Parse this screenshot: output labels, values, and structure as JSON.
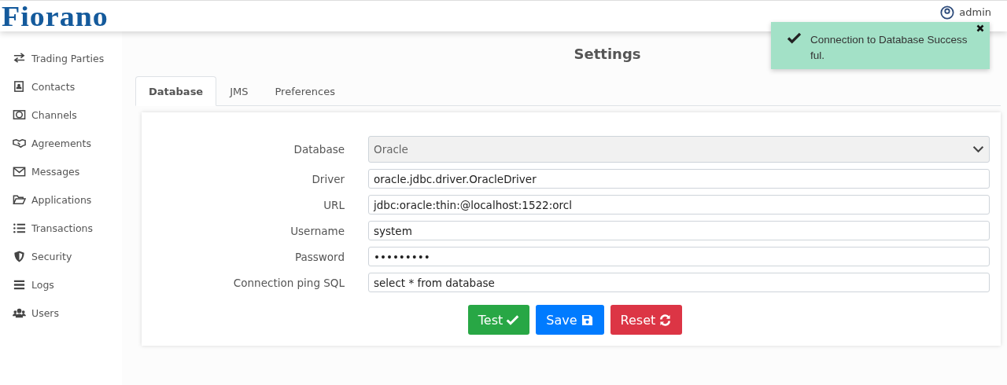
{
  "header": {
    "logo": "Fiorano",
    "user": "admin"
  },
  "sidebar": {
    "items": [
      {
        "label": "Trading Parties"
      },
      {
        "label": "Contacts"
      },
      {
        "label": "Channels"
      },
      {
        "label": "Agreements"
      },
      {
        "label": "Messages"
      },
      {
        "label": "Applications"
      },
      {
        "label": "Transactions"
      },
      {
        "label": "Security"
      },
      {
        "label": "Logs"
      },
      {
        "label": "Users"
      }
    ]
  },
  "page": {
    "title": "Settings"
  },
  "tabs": [
    {
      "label": "Database",
      "selected": true
    },
    {
      "label": "JMS",
      "selected": false
    },
    {
      "label": "Preferences",
      "selected": false
    }
  ],
  "form": {
    "fields": [
      {
        "kind": "select",
        "label": "Database",
        "value": "Oracle"
      },
      {
        "kind": "text",
        "label": "Driver",
        "value": "oracle.jdbc.driver.OracleDriver"
      },
      {
        "kind": "text",
        "label": "URL",
        "value": "jdbc:oracle:thin:@localhost:1522:orcl"
      },
      {
        "kind": "text",
        "label": "Username",
        "value": "system"
      },
      {
        "kind": "text",
        "label": "Password",
        "value": "•••••••••"
      },
      {
        "kind": "text",
        "label": "Connection ping SQL",
        "value": "select * from database"
      }
    ],
    "buttons": [
      {
        "label": "Test",
        "kind": "success"
      },
      {
        "label": "Save",
        "kind": "primary"
      },
      {
        "label": "Reset",
        "kind": "danger"
      }
    ]
  },
  "toast": {
    "message": "Connection to Database Success ful."
  }
}
